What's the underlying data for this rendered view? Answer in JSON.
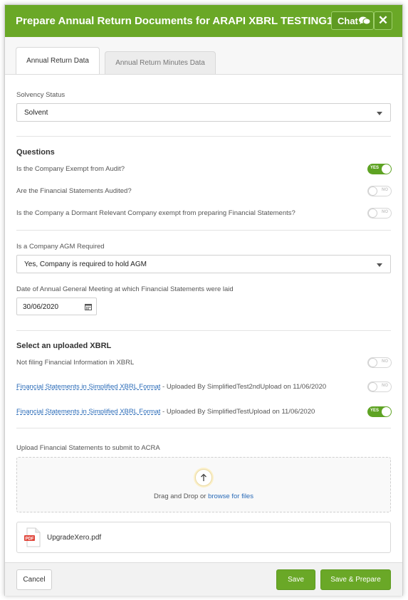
{
  "modal": {
    "title": "Prepare Annual Return Documents for ARAPI XBRL TESTING10",
    "chat_label": "Chat",
    "close_label": "✕"
  },
  "tabs": [
    {
      "label": "Annual Return Data",
      "active": true
    },
    {
      "label": "Annual Return Minutes Data",
      "active": false
    }
  ],
  "solvency": {
    "label": "Solvency Status",
    "value": "Solvent"
  },
  "questions": {
    "title": "Questions",
    "items": [
      {
        "label": "Is the Company Exempt from Audit?",
        "toggle": "YES",
        "on": true
      },
      {
        "label": "Are the Financial Statements Audited?",
        "toggle": "NO",
        "on": false
      },
      {
        "label": "Is the Company a Dormant Relevant Company exempt from preparing Financial Statements?",
        "toggle": "NO",
        "on": false
      }
    ]
  },
  "agm": {
    "label": "Is a Company AGM Required",
    "value": "Yes, Company is required to hold AGM",
    "date_label": "Date of Annual General Meeting at which Financial Statements were laid",
    "date_value": "30/06/2020"
  },
  "xbrl": {
    "title": "Select an uploaded XBRL",
    "not_filing_label": "Not filing Financial Information in XBRL",
    "not_filing_toggle": "NO",
    "items": [
      {
        "link": "Financial Statements in Simplified XBRL Format",
        "detail": " - Uploaded By SimplifiedTest2ndUpload on 11/06/2020",
        "toggle": "NO",
        "on": false
      },
      {
        "link": "Financial Statements in Simplified XBRL Format",
        "detail": " - Uploaded By SimplifiedTestUpload on 11/06/2020",
        "toggle": "YES",
        "on": true
      }
    ]
  },
  "upload": {
    "label": "Upload Financial Statements to submit to ACRA",
    "drop_text": "Drag and Drop or ",
    "browse_text": "browse for files",
    "file_name": "UpgradeXero.pdf"
  },
  "footer": {
    "cancel": "Cancel",
    "save": "Save",
    "save_prepare": "Save & Prepare"
  },
  "colors": {
    "brand_green": "#6aa827",
    "link_blue": "#2a6bb8"
  }
}
